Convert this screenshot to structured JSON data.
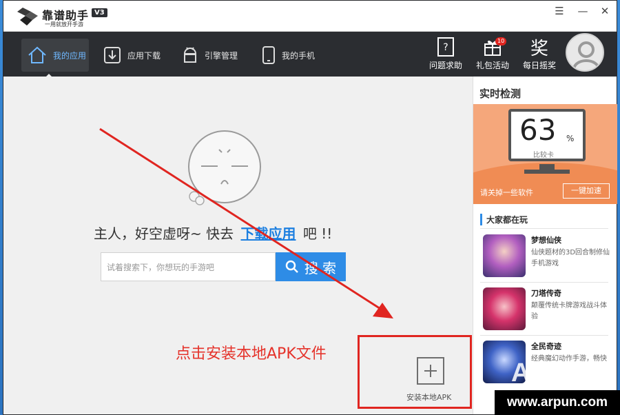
{
  "app": {
    "title": "靠谱助手",
    "version": "V3",
    "slogan": "一用就放开手游"
  },
  "window_controls": {
    "menu": "☰",
    "minimize": "—",
    "close": "✕"
  },
  "nav": {
    "tabs": [
      {
        "label": "我的应用",
        "icon": "home-icon",
        "active": true
      },
      {
        "label": "应用下载",
        "icon": "download-icon"
      },
      {
        "label": "引擎管理",
        "icon": "android-icon"
      },
      {
        "label": "我的手机",
        "icon": "phone-icon"
      }
    ],
    "right": [
      {
        "label": "问题求助",
        "icon": "help-icon"
      },
      {
        "label": "礼包活动",
        "icon": "gift-icon",
        "badge": "10"
      },
      {
        "label": "每日摇奖",
        "icon": "lottery-icon",
        "glyph": "奖"
      }
    ]
  },
  "main": {
    "empty_prefix": "主人，好空虚呀~ 快去",
    "empty_link": "下载应用",
    "empty_suffix": "吧 !!",
    "search_placeholder": "试着搜索下，你想玩的手游吧",
    "search_button": "搜 索",
    "hint": "点击安装本地APK文件",
    "install_label": "安装本地APK"
  },
  "side": {
    "title": "实时检测",
    "score": "63",
    "unit": "%",
    "score_sub": "比较卡",
    "accel_text": "请关掉一些软件",
    "accel_button": "一键加速",
    "popular_title": "大家都在玩",
    "games": [
      {
        "name": "梦想仙侠",
        "desc": "仙侠题材的3D回合制修仙手机游戏"
      },
      {
        "name": "刀塔传奇",
        "desc": "颠覆传统卡牌游戏战斗体验"
      },
      {
        "name": "全民奇迹",
        "desc": "经典魔幻动作手游，畅快"
      }
    ]
  },
  "watermark": {
    "brand": "ARPUN",
    "url": "www.arpun.com"
  },
  "colors": {
    "accent": "#2e8ce6",
    "navbar": "#2b2d31",
    "hint_red": "#e5332b",
    "monitor_bg": "#f5a77b"
  }
}
